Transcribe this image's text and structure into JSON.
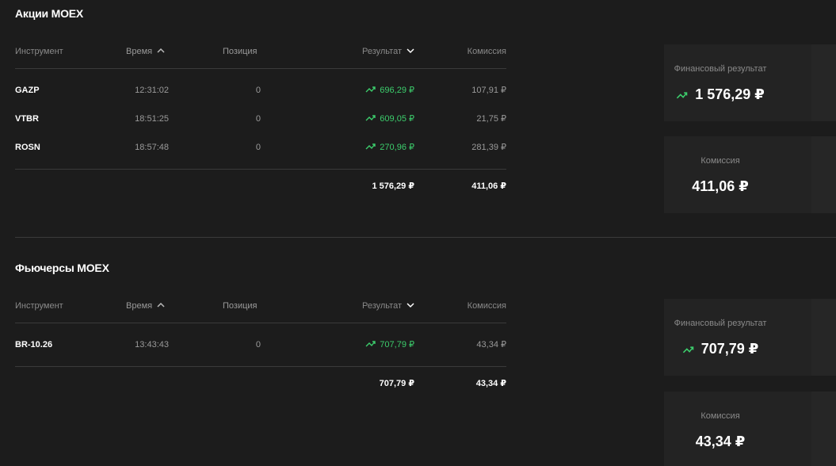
{
  "sections": [
    {
      "title": "Акции MOEX",
      "headers": {
        "instrument": "Инструмент",
        "time": "Время",
        "position": "Позиция",
        "result": "Результат",
        "commission": "Комиссия"
      },
      "rows": [
        {
          "instrument": "GAZP",
          "time": "12:31:02",
          "position": "0",
          "result": "696,29 ₽",
          "commission": "107,91 ₽"
        },
        {
          "instrument": "VTBR",
          "time": "18:51:25",
          "position": "0",
          "result": "609,05 ₽",
          "commission": "21,75 ₽"
        },
        {
          "instrument": "ROSN",
          "time": "18:57:48",
          "position": "0",
          "result": "270,96 ₽",
          "commission": "281,39 ₽"
        }
      ],
      "totals": {
        "result": "1 576,29 ₽",
        "commission": "411,06 ₽"
      },
      "cards": {
        "financial_label": "Финансовый результат",
        "financial_value": "1 576,29 ₽",
        "commission_label": "Комиссия",
        "commission_value": "411,06 ₽"
      }
    },
    {
      "title": "Фьючерсы MOEX",
      "headers": {
        "instrument": "Инструмент",
        "time": "Время",
        "position": "Позиция",
        "result": "Результат",
        "commission": "Комиссия"
      },
      "rows": [
        {
          "instrument": "BR-10.26",
          "time": "13:43:43",
          "position": "0",
          "result": "707,79 ₽",
          "commission": "43,34 ₽"
        }
      ],
      "totals": {
        "result": "707,79 ₽",
        "commission": "43,34 ₽"
      },
      "cards": {
        "financial_label": "Финансовый результат",
        "financial_value": "707,79 ₽",
        "commission_label": "Комиссия",
        "commission_value": "43,34 ₽"
      }
    }
  ],
  "icons": {
    "trend": "trend-up-icon",
    "sort_time": "chevron-up-icon",
    "sort_result": "chevron-down-icon"
  },
  "colors": {
    "background": "#1c1c1c",
    "positive": "#3ccd6c",
    "card": "#232323",
    "muted": "#8a8a8a"
  }
}
